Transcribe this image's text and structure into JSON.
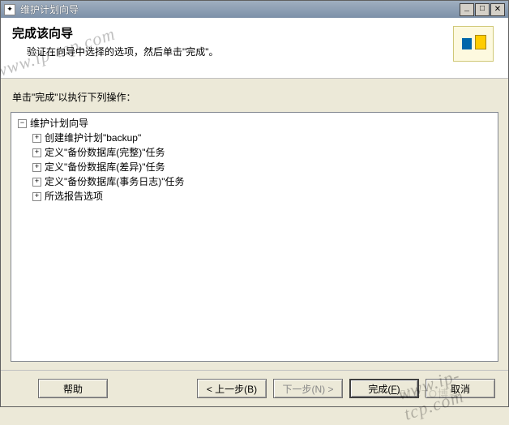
{
  "titlebar": {
    "title": "维护计划向导"
  },
  "header": {
    "title": "完成该向导",
    "subtitle": "验证在向导中选择的选项，然后单击\"完成\"。"
  },
  "instruction": "单击\"完成\"以执行下列操作：",
  "tree": {
    "root": "维护计划向导",
    "children": [
      "创建维护计划\"backup\"",
      "定义\"备份数据库(完整)\"任务",
      "定义\"备份数据库(差异)\"任务",
      "定义\"备份数据库(事务日志)\"任务",
      "所选报告选项"
    ]
  },
  "buttons": {
    "help": "帮助",
    "back": "< 上一步(B)",
    "next": "下一步(N) >",
    "finish_pre": "完成(",
    "finish_k": "F",
    "finish_post": ")",
    "cancel": "取消"
  },
  "toggles": {
    "minus": "−",
    "plus": "+"
  },
  "watermark": {
    "a": "www.ip-tcp.com",
    "b": "www.ip-tcp.com",
    "c": "51CTO博客"
  }
}
